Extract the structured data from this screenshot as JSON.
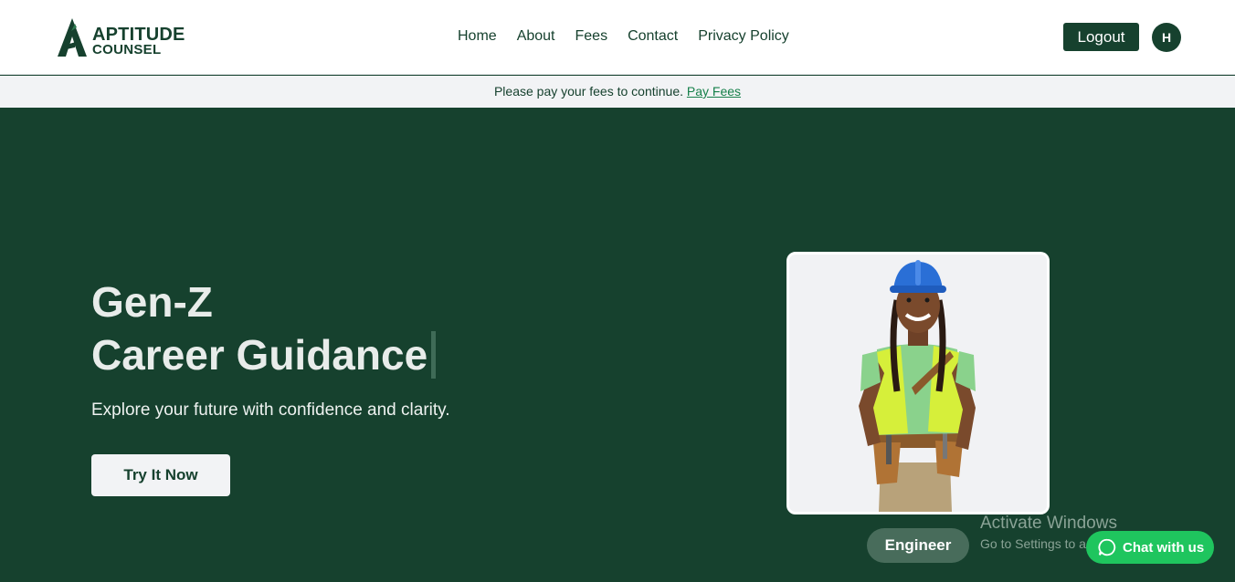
{
  "brand": {
    "line1": "APTITUDE",
    "line2": "COUNSEL",
    "logo_icon": "triangle-a-logo",
    "color": "#16412e"
  },
  "nav": {
    "links": [
      {
        "label": "Home"
      },
      {
        "label": "About"
      },
      {
        "label": "Fees"
      },
      {
        "label": "Contact"
      },
      {
        "label": "Privacy Policy"
      }
    ],
    "logout_label": "Logout",
    "avatar_initial": "H"
  },
  "banner": {
    "text": "Please pay your fees to continue.",
    "link_label": "Pay Fees"
  },
  "hero": {
    "title_line1": "Gen-Z",
    "title_line2": "Career Guidance",
    "subtitle": "Explore your future with confidence and clarity.",
    "cta_label": "Try It Now",
    "career_label": "Engineer",
    "image_icon": "engineer-photo"
  },
  "watermark": {
    "title": "Activate Windows",
    "subtitle": "Go to Settings to activate Windows."
  },
  "chat": {
    "label": "Chat with us",
    "icon": "chat-bubble-icon",
    "color": "#1fc55e"
  },
  "colors": {
    "primary": "#16412e",
    "background_light": "#f2f3f5",
    "link": "#16804a"
  }
}
